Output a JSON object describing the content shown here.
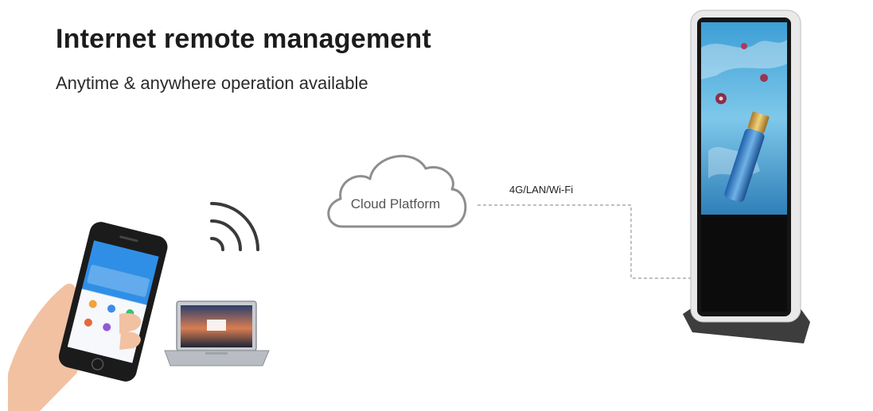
{
  "header": {
    "title": "Internet remote management",
    "subtitle": "Anytime & anywhere operation available"
  },
  "diagram": {
    "cloud_label": "Cloud Platform",
    "connection_label": "4G/LAN/Wi-Fi",
    "nodes": [
      {
        "id": "smartphone",
        "icon": "smartphone-icon"
      },
      {
        "id": "laptop",
        "icon": "laptop-icon"
      },
      {
        "id": "wifi-signal",
        "icon": "wifi-signal-icon"
      },
      {
        "id": "cloud",
        "icon": "cloud-icon"
      },
      {
        "id": "kiosk",
        "icon": "digital-signage-kiosk-icon"
      }
    ]
  }
}
